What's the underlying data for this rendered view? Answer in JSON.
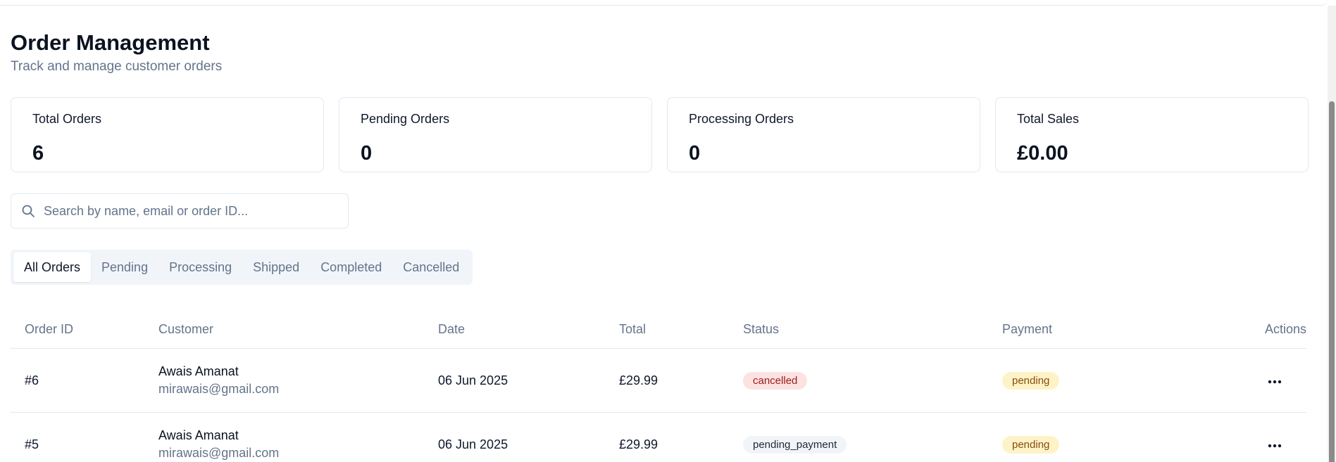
{
  "header": {
    "title": "Order Management",
    "subtitle": "Track and manage customer orders"
  },
  "stats": [
    {
      "label": "Total Orders",
      "value": "6"
    },
    {
      "label": "Pending Orders",
      "value": "0"
    },
    {
      "label": "Processing Orders",
      "value": "0"
    },
    {
      "label": "Total Sales",
      "value": "£0.00"
    }
  ],
  "search": {
    "placeholder": "Search by name, email or order ID...",
    "value": "",
    "icon": "search-icon"
  },
  "tabs": [
    {
      "label": "All Orders",
      "active": true
    },
    {
      "label": "Pending",
      "active": false
    },
    {
      "label": "Processing",
      "active": false
    },
    {
      "label": "Shipped",
      "active": false
    },
    {
      "label": "Completed",
      "active": false
    },
    {
      "label": "Cancelled",
      "active": false
    }
  ],
  "table": {
    "columns": [
      "Order ID",
      "Customer",
      "Date",
      "Total",
      "Status",
      "Payment",
      "Actions"
    ],
    "rows": [
      {
        "id": "#6",
        "customer_name": "Awais Amanat",
        "customer_email": "mirawais@gmail.com",
        "date": "06 Jun 2025",
        "total": "£29.99",
        "status": "cancelled",
        "payment": "pending"
      },
      {
        "id": "#5",
        "customer_name": "Awais Amanat",
        "customer_email": "mirawais@gmail.com",
        "date": "06 Jun 2025",
        "total": "£29.99",
        "status": "pending_payment",
        "payment": "pending"
      }
    ]
  },
  "colors": {
    "status_cancelled_bg": "#fde2e2",
    "status_cancelled_text": "#991b1b",
    "payment_pending_bg": "#fef3c7",
    "payment_pending_text": "#854d0e",
    "muted_text": "#64748b"
  }
}
